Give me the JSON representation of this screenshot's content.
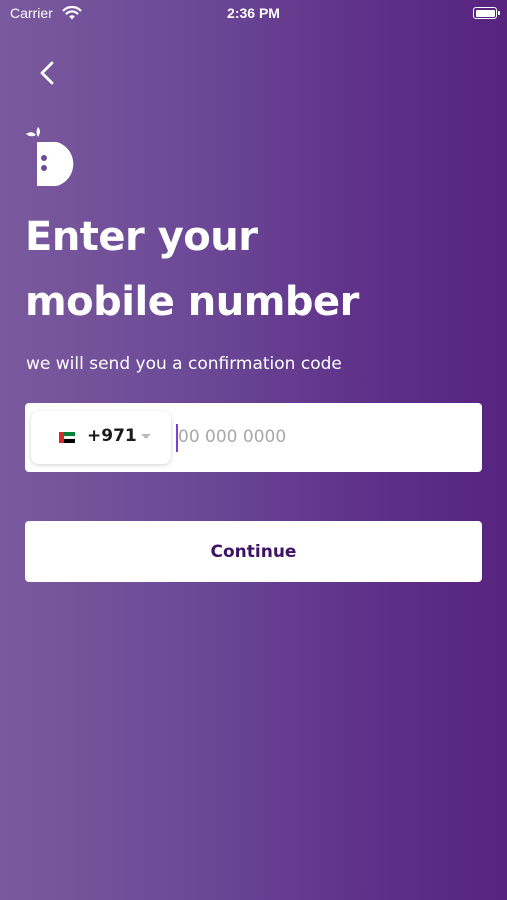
{
  "status_bar": {
    "carrier": "Carrier",
    "time": "2:36 PM"
  },
  "icons": {
    "back": "chevron-left-icon",
    "logo": "d-logo-icon",
    "wifi": "wifi-icon",
    "battery": "battery-icon",
    "flag": "uae-flag-icon",
    "dropdown": "chevron-down-icon"
  },
  "heading": {
    "line1": "Enter your",
    "line2": "mobile number"
  },
  "subtitle": "we will send you a confirmation code",
  "phone": {
    "dial_code": "+971",
    "placeholder": "00 000 0000",
    "value": ""
  },
  "continue_label": "Continue",
  "colors": {
    "bg_start": "#7a5a9e",
    "bg_end": "#57247f",
    "button_text": "#3e1266",
    "cursor": "#7b3fd6"
  }
}
